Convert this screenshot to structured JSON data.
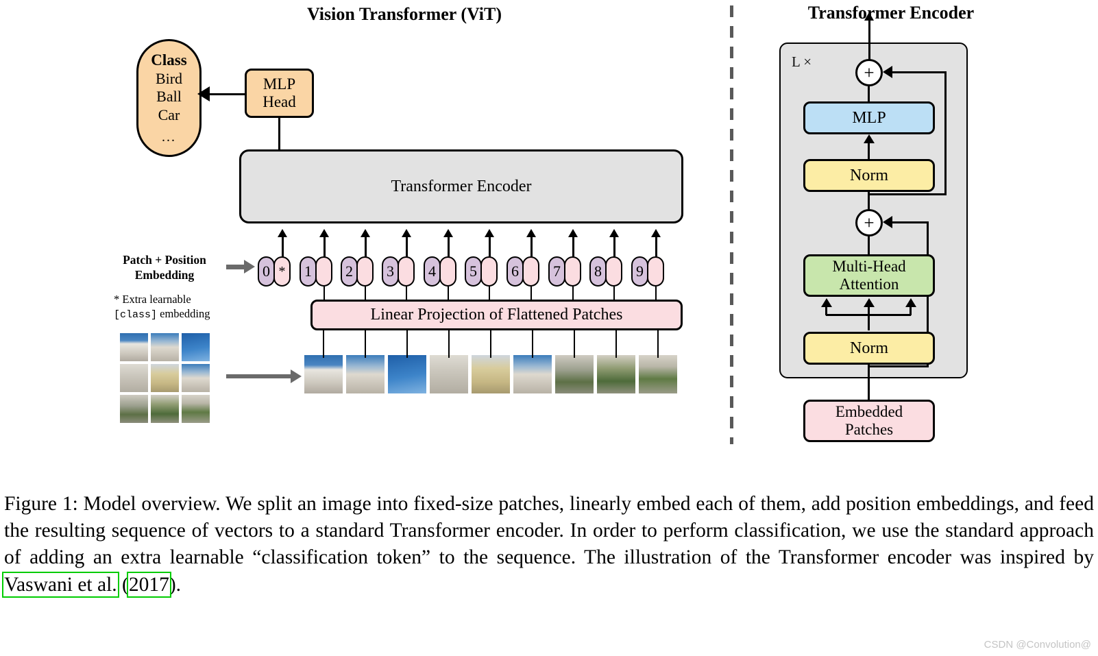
{
  "titles": {
    "left": "Vision Transformer (ViT)",
    "right": "Transformer Encoder"
  },
  "left_panel": {
    "class_box": {
      "heading": "Class",
      "items": [
        "Bird",
        "Ball",
        "Car"
      ],
      "ellipsis": "...",
      "color": "#fad5a5"
    },
    "mlp_head": {
      "line1": "MLP",
      "line2": "Head",
      "color": "#fad5a5"
    },
    "transformer_encoder": {
      "label": "Transformer Encoder",
      "color": "#e2e2e2"
    },
    "linear_projection": {
      "label": "Linear Projection of Flattened Patches",
      "color": "#fbdde1"
    },
    "patch_position_label": {
      "line1": "Patch + Position",
      "line2": "Embedding"
    },
    "extra_learnable_note": {
      "prefix": "* Extra learnable",
      "mono": "[class]",
      "suffix": " embedding"
    },
    "tokens": [
      {
        "index": "0",
        "star": "*",
        "has_star": true
      },
      {
        "index": "1",
        "star": "",
        "has_star": false
      },
      {
        "index": "2",
        "star": "",
        "has_star": false
      },
      {
        "index": "3",
        "star": "",
        "has_star": false
      },
      {
        "index": "4",
        "star": "",
        "has_star": false
      },
      {
        "index": "5",
        "star": "",
        "has_star": false
      },
      {
        "index": "6",
        "star": "",
        "has_star": false
      },
      {
        "index": "7",
        "star": "",
        "has_star": false
      },
      {
        "index": "8",
        "star": "",
        "has_star": false
      },
      {
        "index": "9",
        "star": "",
        "has_star": false
      }
    ],
    "token_colors": {
      "number_capsule": "#d6c2dc",
      "embedding_capsule": "#fbdde1"
    },
    "source_image_grid": {
      "rows": 3,
      "cols": 3,
      "description": "photograph of a palace split into 9 fixed-size patches"
    },
    "flattened_patch_count": 9
  },
  "right_panel": {
    "repeat_label": "L ×",
    "panel_color": "#e2e2e2",
    "blocks": [
      {
        "label": "MLP",
        "color": "#bcdff5"
      },
      {
        "label": "Norm",
        "color": "#fceda5"
      },
      {
        "label_line1": "Multi-Head",
        "label_line2": "Attention",
        "color": "#c8e6ac"
      },
      {
        "label": "Norm",
        "color": "#fceda5"
      },
      {
        "label_line1": "Embedded",
        "label_line2": "Patches",
        "color": "#fbdde1"
      }
    ],
    "mlp_label": "MLP",
    "norm_top_label": "Norm",
    "mha_line1": "Multi-Head",
    "mha_line2": "Attention",
    "norm_bottom_label": "Norm",
    "embedded_line1": "Embedded",
    "embedded_line2": "Patches",
    "residual_symbol": "+"
  },
  "caption": {
    "seg1": "Figure 1: Model overview. We split an image into fixed-size patches, linearly embed each of them, add position embeddings, and feed the resulting sequence of vectors to a standard Transformer encoder. In order to perform classification, we use the standard approach of adding an extra learnable “classification token” to the sequence. The illustration of the Transformer encoder was inspired by ",
    "link1": "Vaswani et al.",
    "between": " (",
    "link2": "2017",
    "seg_end": ")."
  },
  "watermark": "CSDN @Convolution@"
}
